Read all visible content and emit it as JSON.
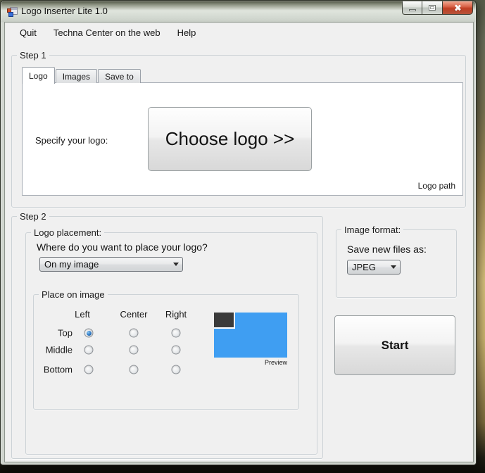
{
  "window": {
    "title": "Logo Inserter Lite 1.0"
  },
  "menu": {
    "items": [
      "Quit",
      "Techna Center on the web",
      "Help"
    ]
  },
  "step1": {
    "legend": "Step 1",
    "tabs": [
      {
        "label": "Logo",
        "active": true
      },
      {
        "label": "Images",
        "active": false
      },
      {
        "label": "Save to",
        "active": false
      }
    ],
    "specify_label": "Specify your logo:",
    "choose_button_label": "Choose logo >>",
    "logo_path_label": "Logo path"
  },
  "step2": {
    "legend": "Step 2",
    "logo_placement": {
      "legend": "Logo placement:",
      "question": "Where do you want to place your logo?",
      "placement_select": {
        "value": "On my image"
      },
      "place_on_image": {
        "legend": "Place on image",
        "columns": [
          "Left",
          "Center",
          "Right"
        ],
        "rows": [
          "Top",
          "Middle",
          "Bottom"
        ],
        "selected": {
          "row": "Top",
          "col": "Left"
        },
        "preview_label": "Preview"
      }
    }
  },
  "image_format": {
    "legend": "Image format:",
    "save_label": "Save new files as:",
    "format_select": {
      "value": "JPEG"
    }
  },
  "start_button_label": "Start",
  "colors": {
    "preview_image_blue": "#3f9ef2",
    "preview_logo_dark": "#3a3a3a",
    "close_button_red": "#c03e23",
    "radio_selected_blue": "#2c77c4",
    "client_background": "#f0f0f0"
  }
}
